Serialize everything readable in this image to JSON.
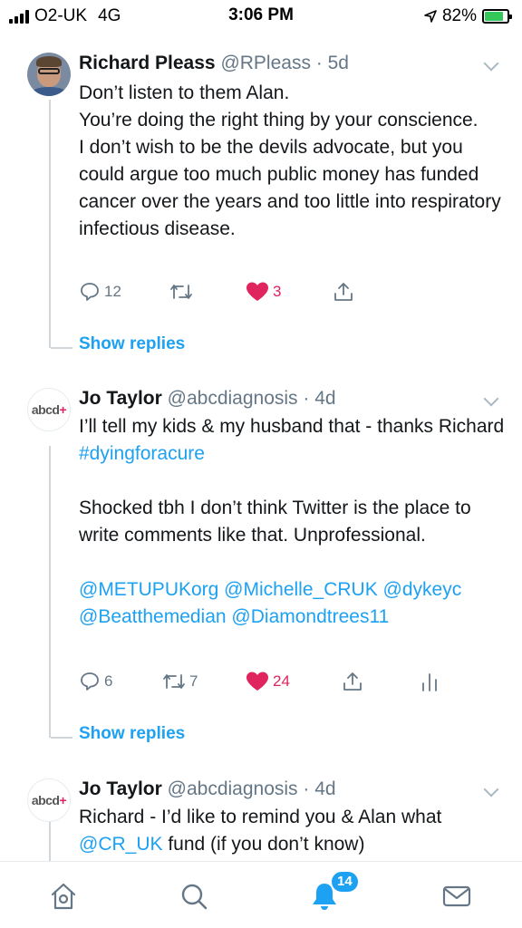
{
  "status_bar": {
    "carrier": "O2-UK",
    "network": "4G",
    "time": "3:06 PM",
    "battery_percent": "82%",
    "battery_level": 0.82
  },
  "tweets": [
    {
      "name": "Richard Pleass",
      "handle": "@RPleass",
      "age": "5d",
      "lines": [
        "Don’t listen to them Alan.",
        "You’re doing the right thing by your conscience.",
        "I don’t wish to be the devils advocate, but you could argue too much public money has funded cancer over the years and too little into respiratory infectious disease."
      ],
      "replies": "12",
      "retweets": "",
      "likes": "3",
      "show_replies": "Show replies"
    },
    {
      "name": "Jo Taylor",
      "handle": "@abcdiagnosis",
      "age": "4d",
      "line1_text": "I’ll tell my kids & my husband that - thanks Richard ",
      "line1_hashtag": "#dyingforacure",
      "line2": "Shocked tbh I don’t think Twitter is the place to write comments like that. Unprofessional.",
      "mentions": "@METUPUKorg @Michelle_CRUK @dykeyc @Beatthemedian @Diamondtrees11",
      "replies": "6",
      "retweets": "7",
      "likes": "24",
      "show_replies": "Show replies",
      "avatar_text": "abcd"
    },
    {
      "name": "Jo Taylor",
      "handle": "@abcdiagnosis",
      "age": "4d",
      "text_before": "Richard - I’d like to remind you & Alan what ",
      "mention": "@CR_UK",
      "text_after": " fund (if you don’t know)",
      "avatar_text": "abcd"
    }
  ],
  "tab_bar": {
    "notifications_badge": "14"
  },
  "colors": {
    "accent": "#1da1f2",
    "like": "#e0245e",
    "secondary_text": "#657786"
  }
}
